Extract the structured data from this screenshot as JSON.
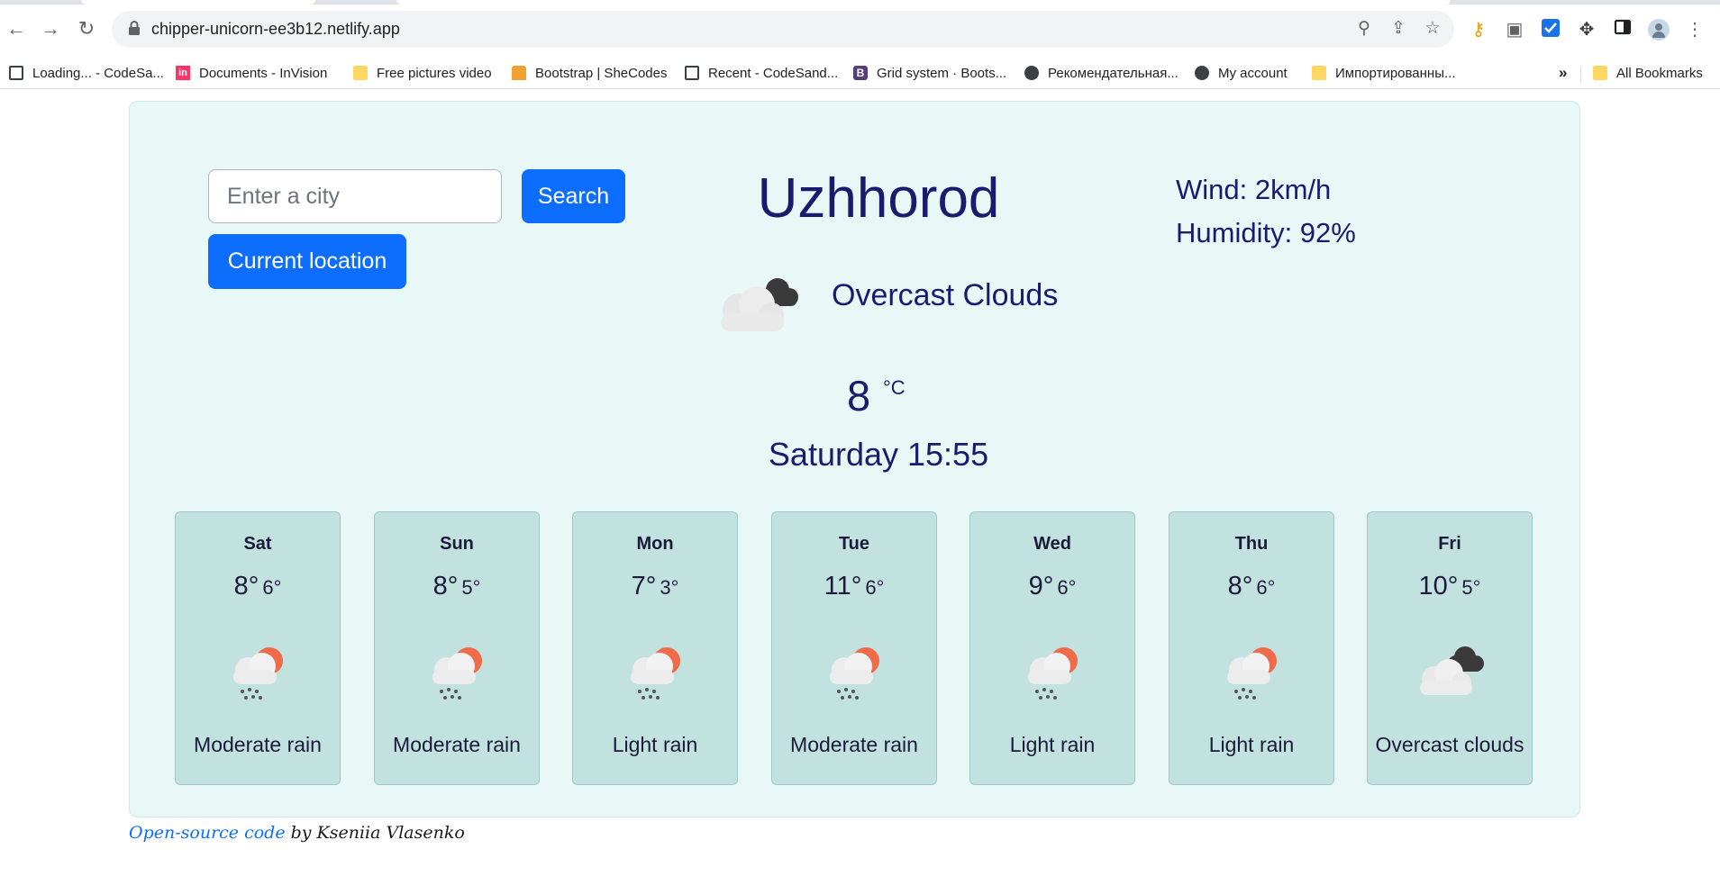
{
  "browser": {
    "url": "chipper-unicorn-ee3b12.netlify.app",
    "bookmarks": [
      {
        "label": "Loading... - CodeSa...",
        "icon": "square-outline-icon"
      },
      {
        "label": "Documents - InVision",
        "icon": "invision-icon"
      },
      {
        "label": "Free pictures video",
        "icon": "folder-icon"
      },
      {
        "label": "Bootstrap | SheCodes",
        "icon": "shecodes-icon"
      },
      {
        "label": "Recent - CodeSand...",
        "icon": "square-outline-icon"
      },
      {
        "label": "Grid system · Boots...",
        "icon": "bootstrap-icon"
      },
      {
        "label": "Рекомендательная...",
        "icon": "globe-icon"
      },
      {
        "label": "My account",
        "icon": "globe-icon"
      },
      {
        "label": "Импортированны...",
        "icon": "folder-icon"
      }
    ],
    "more_bookmarks": "»",
    "all_bookmarks": "All Bookmarks"
  },
  "search": {
    "placeholder": "Enter a city",
    "button_label": "Search",
    "location_button_label": "Current location"
  },
  "current": {
    "city": "Uzhhorod",
    "wind": "Wind: 2km/h",
    "humidity": "Humidity: 92%",
    "description": "Overcast Clouds",
    "temperature": "8",
    "unit": "°C",
    "datetime": "Saturday 15:55",
    "icon": "overcast-clouds-icon"
  },
  "forecast": [
    {
      "day": "Sat",
      "max": "8°",
      "min": "6°",
      "desc": "Moderate rain",
      "icon": "rain-sun-icon"
    },
    {
      "day": "Sun",
      "max": "8°",
      "min": "5°",
      "desc": "Moderate rain",
      "icon": "rain-sun-icon"
    },
    {
      "day": "Mon",
      "max": "7°",
      "min": "3°",
      "desc": "Light rain",
      "icon": "rain-sun-icon"
    },
    {
      "day": "Tue",
      "max": "11°",
      "min": "6°",
      "desc": "Moderate rain",
      "icon": "rain-sun-icon"
    },
    {
      "day": "Wed",
      "max": "9°",
      "min": "6°",
      "desc": "Light rain",
      "icon": "rain-sun-icon"
    },
    {
      "day": "Thu",
      "max": "8°",
      "min": "6°",
      "desc": "Light rain",
      "icon": "rain-sun-icon"
    },
    {
      "day": "Fri",
      "max": "10°",
      "min": "5°",
      "desc": "Overcast clouds",
      "icon": "overcast-clouds-icon"
    }
  ],
  "footer": {
    "link_text": "Open-source code",
    "author_text": " by Kseniia Vlasenko"
  },
  "colors": {
    "primary_button": "#0d6efd",
    "card_background": "#e8f8f7",
    "forecast_card": "#c2e2e0",
    "heading_text": "#1a1a6e"
  }
}
